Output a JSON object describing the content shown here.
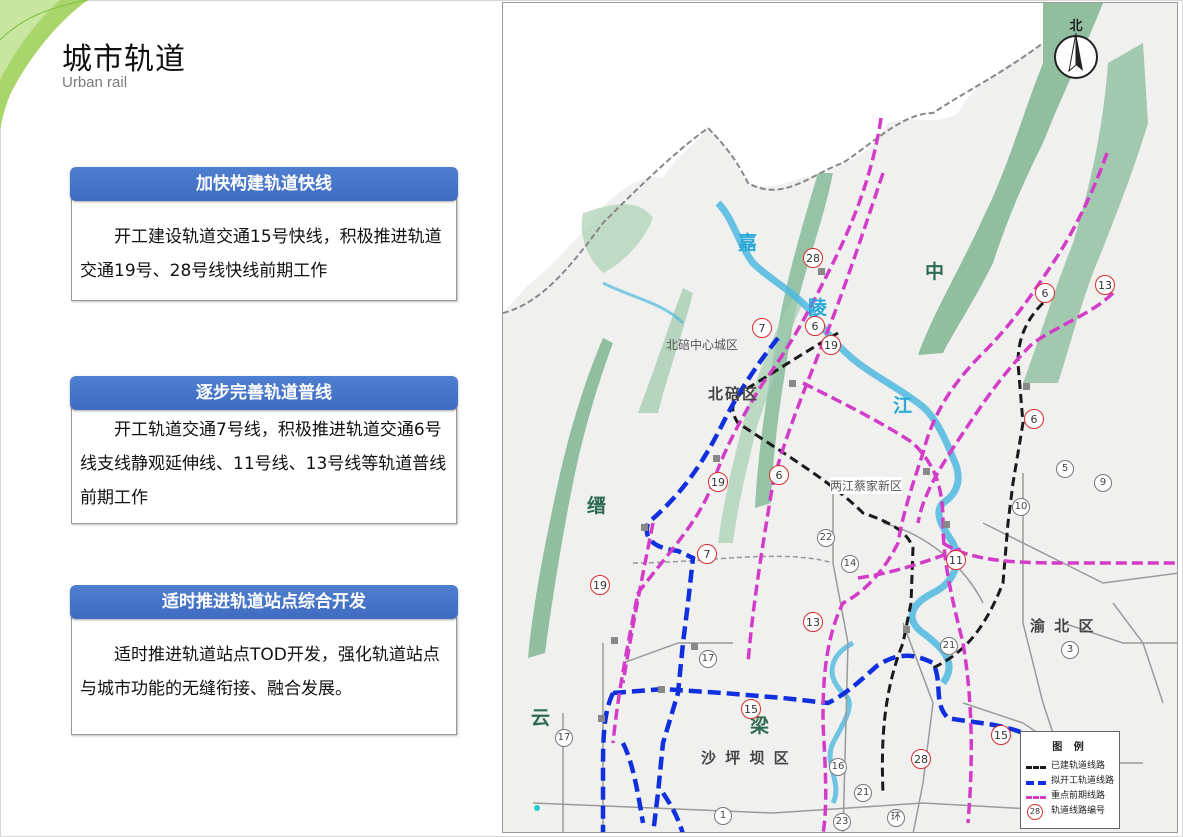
{
  "header": {
    "title": "城市轨道",
    "subtitle": "Urban rail"
  },
  "cards": [
    {
      "heading": "加快构建轨道快线",
      "body": "开工建设轨道交通15号快线，积极推进轨道交通19号、28号线快线前期工作"
    },
    {
      "heading": "逐步完善轨道普线",
      "body": "开工轨道交通7号线，积极推进轨道交通6号线支线静观延伸线、11号线、13号线等轨道普线前期工作"
    },
    {
      "heading": "适时推进轨道站点综合开发",
      "body": "适时推进轨道站点TOD开发，强化轨道站点与城市功能的无缝衔接、融合发展。"
    }
  ],
  "map": {
    "north_label": "北",
    "places": [
      "北碚区",
      "北碚中心城区",
      "两江蔡家新区",
      "渝 北 区",
      "沙 坪 坝 区"
    ],
    "rivers": [
      "嘉",
      "陵",
      "江"
    ],
    "mountains": [
      "中",
      "缙",
      "云",
      "梁"
    ],
    "line_badges": [
      "28",
      "7",
      "6",
      "19",
      "6",
      "13",
      "6",
      "19",
      "6",
      "7",
      "19",
      "11",
      "13",
      "15",
      "28",
      "15"
    ],
    "existing_badges": [
      "5",
      "9",
      "10",
      "22",
      "14",
      "21",
      "3",
      "17",
      "17",
      "16",
      "21",
      "23",
      "1",
      "环"
    ],
    "legend": {
      "title": "图 例",
      "items": [
        "已建轨道线路",
        "拟开工轨道线路",
        "重点前期线路",
        "轨道线路编号"
      ],
      "sample_badge": "28",
      "colors": {
        "built": "#1a1a1a",
        "planned": "#1030e0",
        "priority": "#d23cc8",
        "badge": "#d92b2b"
      }
    }
  },
  "colors": {
    "accent": "#4472c4",
    "leaf": "#92d050",
    "river": "#29a9d8"
  }
}
